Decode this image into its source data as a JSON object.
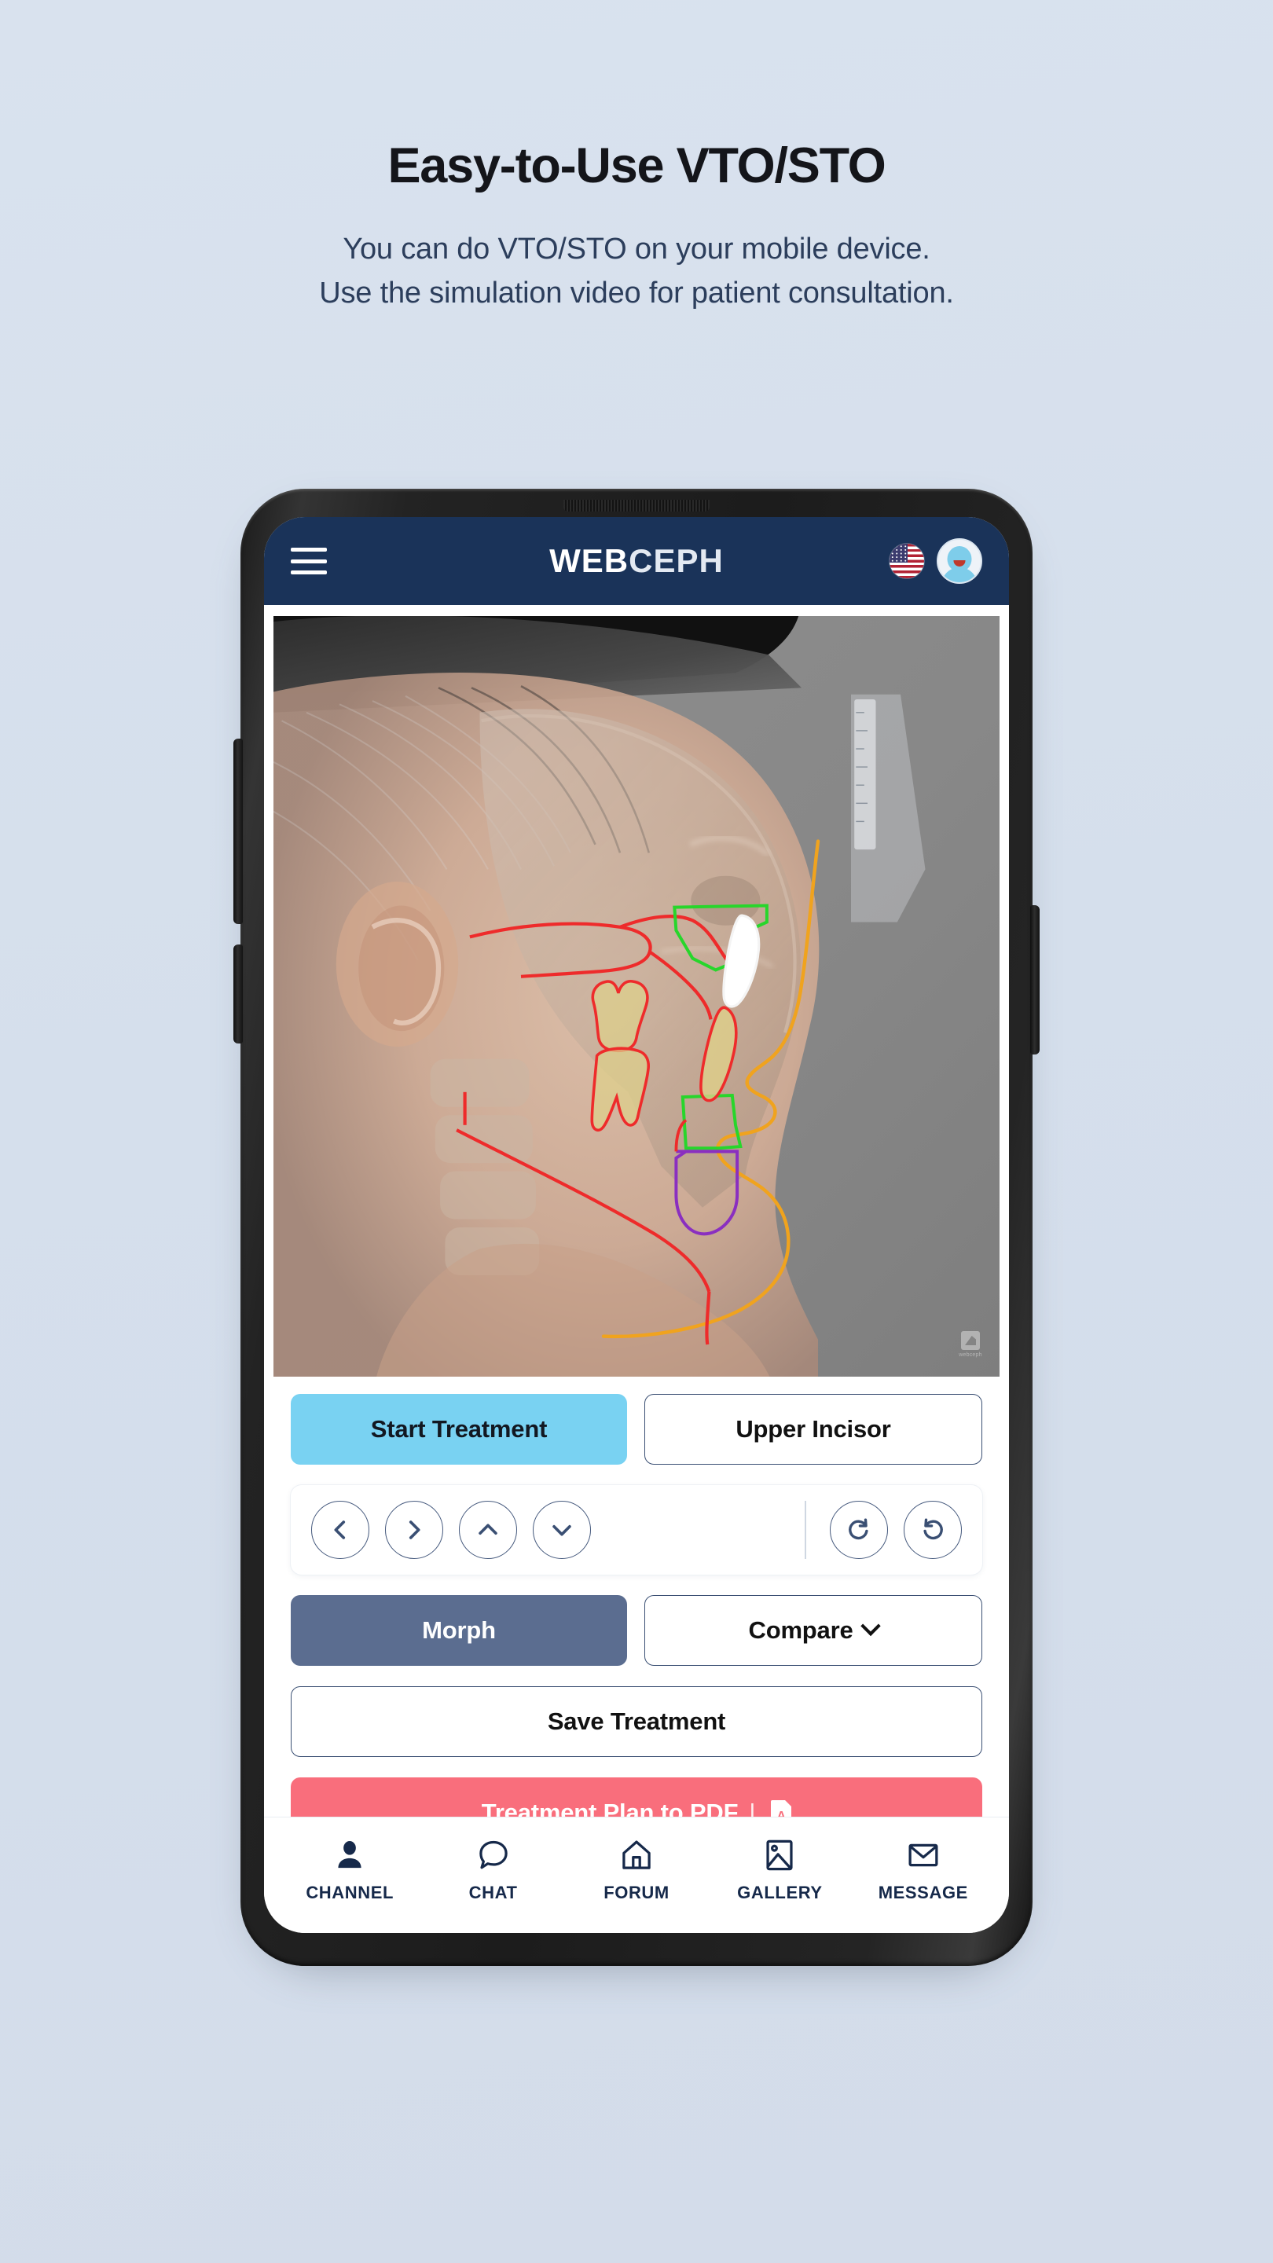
{
  "hero": {
    "headline": "Easy-to-Use VTO/STO",
    "subhead_line1": "You can do VTO/STO on your mobile device.",
    "subhead_line2": "Use the simulation video for patient consultation."
  },
  "app": {
    "header": {
      "menu_icon": "hamburger-menu-icon",
      "logo_part1": "WEB",
      "logo_part2": "CEPH",
      "language_icon": "us-flag-icon",
      "avatar_icon": "user-avatar-icon"
    },
    "viewer": {
      "title": "cephalometric-tracing-viewer",
      "watermark_label": "webceph",
      "tracing_colors": {
        "skeletal": "#ee2b2b",
        "soft_tissue": "#f0a31e",
        "incisor_box": "#27d62b",
        "tooth_fill": "#ded08a",
        "chin": "#8a2fc0",
        "lip_highlight": "#ffffff"
      }
    },
    "controls": {
      "start_treatment": "Start Treatment",
      "upper_incisor": "Upper Incisor",
      "nav": {
        "left": "chevron-left-icon",
        "right": "chevron-right-icon",
        "up": "chevron-up-icon",
        "down": "chevron-down-icon",
        "redo": "rotate-clockwise-icon",
        "undo": "rotate-counterclockwise-icon"
      },
      "morph": "Morph",
      "compare": "Compare",
      "save_treatment": "Save Treatment",
      "pdf_label": "Treatment Plan to PDF",
      "pdf_separator": "|",
      "pdf_icon": "pdf-file-icon"
    },
    "tabbar": [
      {
        "label": "CHANNEL",
        "icon": "person-icon",
        "active": true
      },
      {
        "label": "CHAT",
        "icon": "speech-bubble-icon",
        "active": false
      },
      {
        "label": "FORUM",
        "icon": "home-icon",
        "active": false
      },
      {
        "label": "GALLERY",
        "icon": "image-icon",
        "active": false
      },
      {
        "label": "MESSAGE",
        "icon": "envelope-icon",
        "active": false
      }
    ]
  },
  "colors": {
    "background": "#d7e0ec",
    "header_navy": "#1a3359",
    "primary_blue": "#79d2f2",
    "slate": "#5b6d90",
    "danger": "#f96e7c",
    "text_dark": "#14151a",
    "text_muted": "#2c3e5c"
  }
}
